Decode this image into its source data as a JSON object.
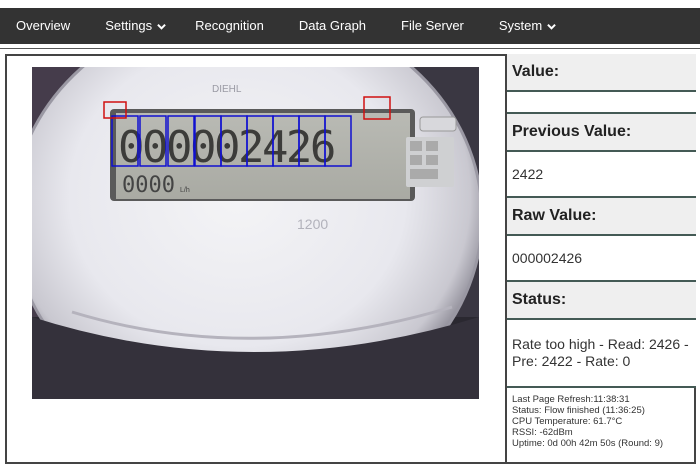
{
  "nav": {
    "items": [
      {
        "label": "Overview",
        "dropdown": false
      },
      {
        "label": "Settings",
        "dropdown": true
      },
      {
        "label": "Recognition",
        "dropdown": false
      },
      {
        "label": "Data Graph",
        "dropdown": false
      },
      {
        "label": "File Server",
        "dropdown": false
      },
      {
        "label": "System",
        "dropdown": true
      }
    ]
  },
  "camera": {
    "digit_display": "000002426",
    "subdisplay": "0000",
    "subdisplay_unit": "L/h",
    "brand_text": "DIEHL",
    "bottom_text": "1200",
    "roi_color_digits": "#1010d0",
    "roi_color_alignment": "#d01010"
  },
  "panel": {
    "value_label": "Value:",
    "value": "",
    "previous_label": "Previous Value:",
    "previous_value": "2422",
    "raw_label": "Raw Value:",
    "raw_value": "000002426",
    "status_label": "Status:",
    "status_value": "Rate too high - Read: 2426 - Pre: 2422 - Rate: 0"
  },
  "info": {
    "last_refresh": "Last Page Refresh:11:38:31",
    "status": "Status: Flow finished (11:36:25)",
    "cpu_temp": "CPU Temperature: 61.7°C",
    "rssi": "RSSI: -62dBm",
    "uptime": "Uptime: 0d 00h 42m 50s (Round: 9)"
  },
  "colors": {
    "nav_bg": "#333333",
    "panel_header_bg": "#efefef",
    "border": "#445a55"
  }
}
